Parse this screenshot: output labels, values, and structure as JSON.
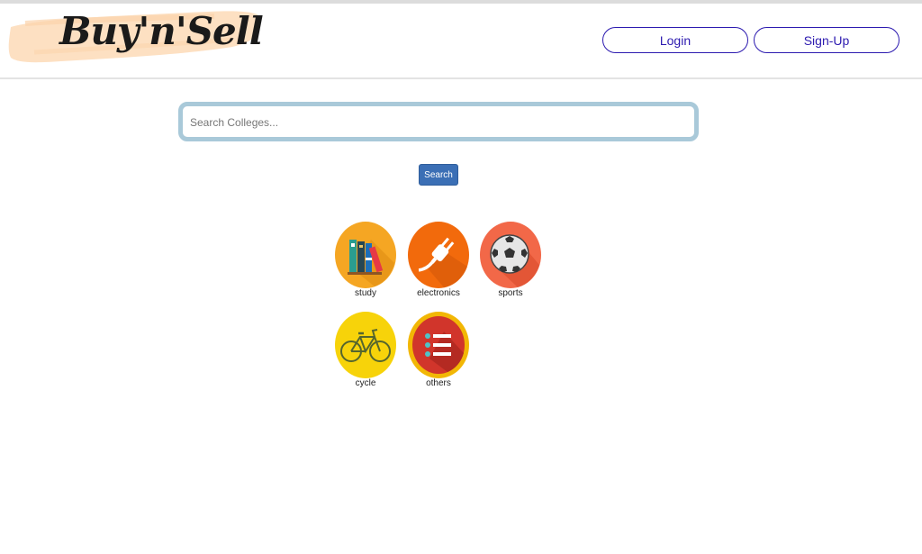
{
  "header": {
    "logo_text": "Buy'n'Sell",
    "login_label": "Login",
    "signup_label": "Sign-Up"
  },
  "search": {
    "placeholder": "Search Colleges...",
    "button_label": "Search"
  },
  "categories": [
    {
      "label": "study",
      "icon": "books-icon",
      "color": "#f5a623"
    },
    {
      "label": "electronics",
      "icon": "plug-icon",
      "color": "#f26a0c"
    },
    {
      "label": "sports",
      "icon": "soccer-ball-icon",
      "color": "#f26848"
    },
    {
      "label": "cycle",
      "icon": "bicycle-icon",
      "color": "#f7d30a"
    },
    {
      "label": "others",
      "icon": "list-icon",
      "color": "#f2b705"
    }
  ]
}
